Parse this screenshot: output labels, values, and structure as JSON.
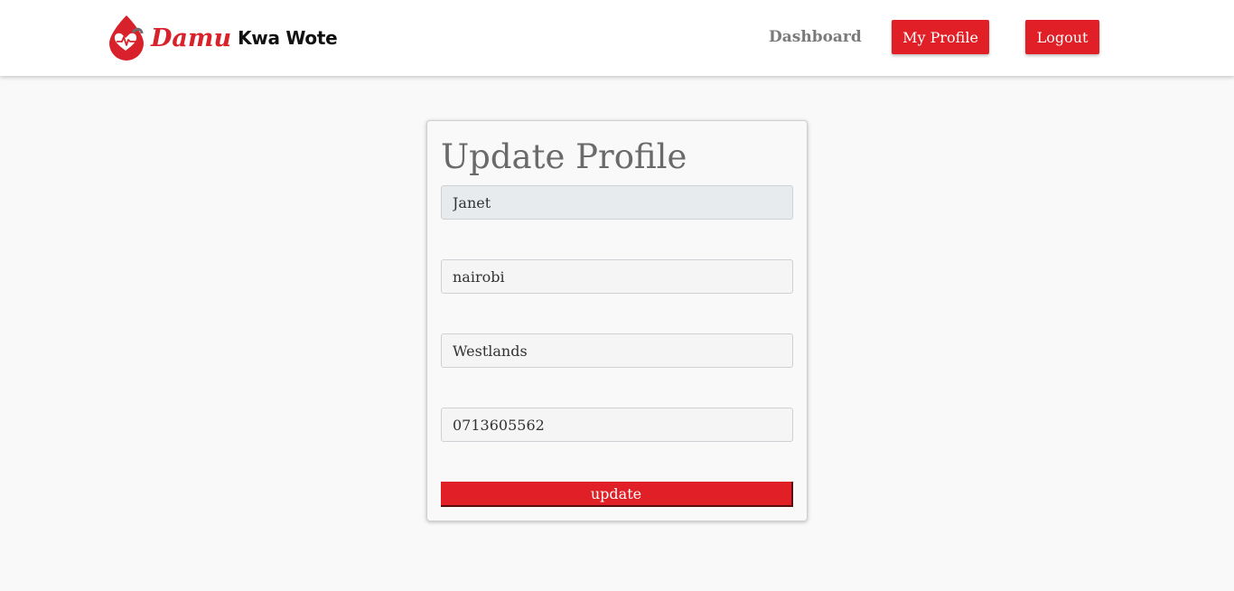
{
  "brand": {
    "name_script": "Damu",
    "name_rest": "Kwa Wote",
    "logo_icon": "blood-drop-heartbeat-icon",
    "color_primary": "#e01f26"
  },
  "nav": {
    "dashboard_label": "Dashboard",
    "profile_label": "My Profile",
    "logout_label": "Logout"
  },
  "form": {
    "title": "Update Profile",
    "fields": [
      {
        "value": "Janet",
        "readonly": true
      },
      {
        "value": "nairobi",
        "readonly": false
      },
      {
        "value": "Westlands",
        "readonly": false
      },
      {
        "value": "0713605562",
        "readonly": false
      }
    ],
    "submit_label": "update"
  }
}
